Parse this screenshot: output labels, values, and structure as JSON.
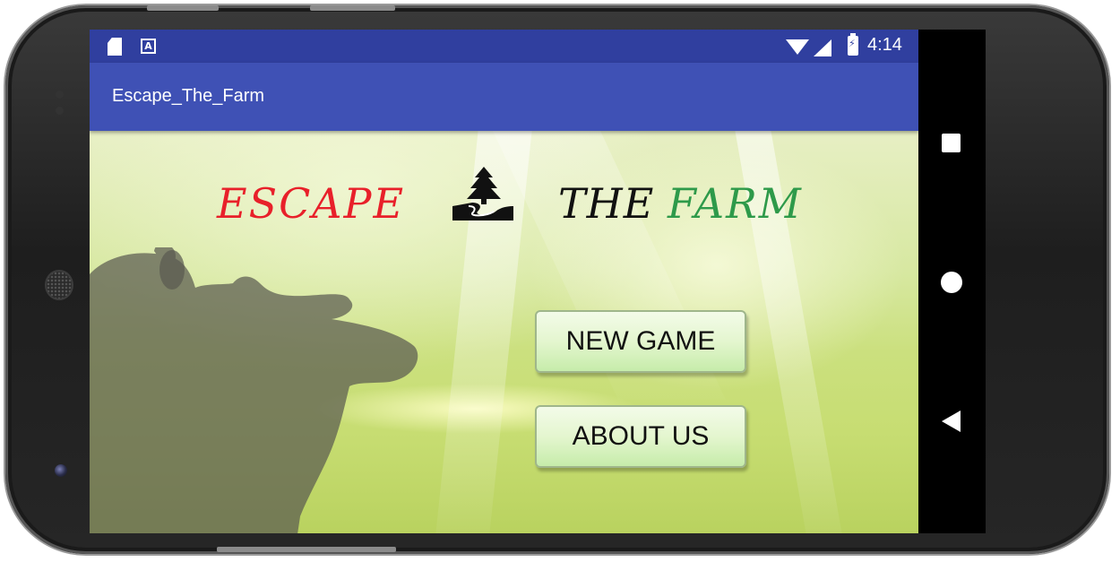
{
  "status_bar": {
    "time": "4:14",
    "icons": [
      "sd-card-icon",
      "a-notification-icon",
      "wifi-icon",
      "signal-icon",
      "battery-charging-icon"
    ],
    "color": "#303f9f"
  },
  "app_bar": {
    "title": "Escape_The_Farm",
    "color": "#3f51b5"
  },
  "main": {
    "logo": {
      "word1": "ESCAPE",
      "word2": "THE",
      "word3": "FARM",
      "word1_color": "#e8202a",
      "word2_color": "#111111",
      "word3_color": "#2e9a4a"
    },
    "buttons": {
      "new_game": "NEW GAME",
      "about_us": "ABOUT US"
    }
  },
  "nav_bar": {
    "items": [
      "recents-square-icon",
      "home-circle-icon",
      "back-triangle-icon"
    ]
  }
}
